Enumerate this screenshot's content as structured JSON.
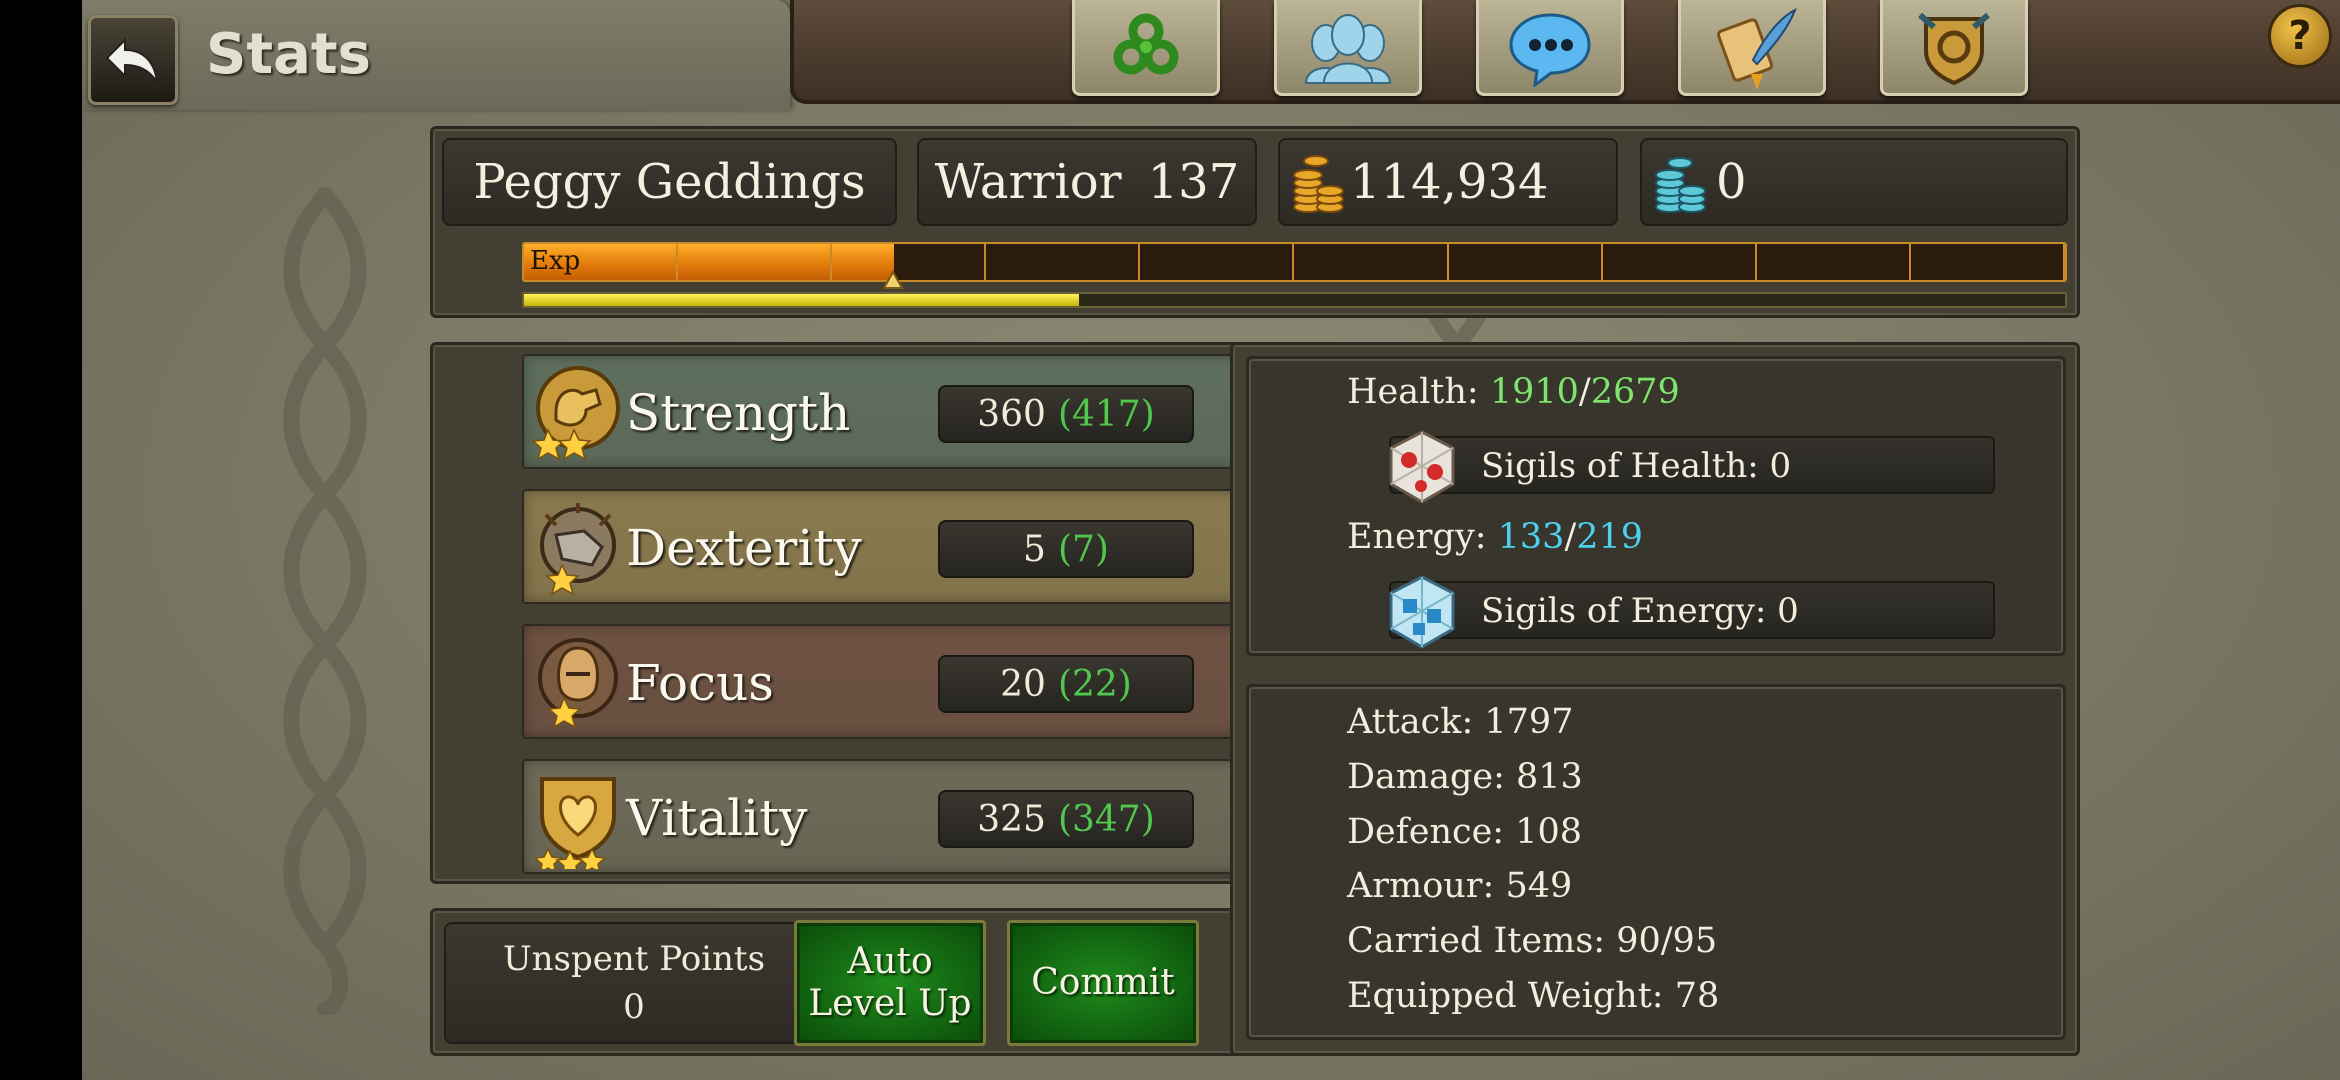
{
  "header": {
    "title": "Stats",
    "nav_buttons": [
      {
        "name": "triskele-icon",
        "color": "#3f9a2a"
      },
      {
        "name": "guild-icon",
        "color": "#8cc8e0"
      },
      {
        "name": "chat-icon",
        "color": "#4aa6e8"
      },
      {
        "name": "quest-scroll-icon",
        "color": "#d9a54a"
      },
      {
        "name": "crest-icon",
        "color": "#c99a3a"
      }
    ],
    "help_label": "?"
  },
  "character": {
    "name": "Peggy Geddings",
    "class": "Warrior",
    "level": "137",
    "gold": "114,934",
    "gems": "0"
  },
  "experience": {
    "label": "Exp",
    "segments": 10,
    "progress": 0.24,
    "sub_progress": 0.36
  },
  "attributes": [
    {
      "name": "Strength",
      "base": "360",
      "total": "(417)",
      "icon": "strength-icon",
      "color": "#5f6f5e"
    },
    {
      "name": "Dexterity",
      "base": "5",
      "total": "(7)",
      "icon": "dexterity-icon",
      "color": "#8a7a4e"
    },
    {
      "name": "Focus",
      "base": "20",
      "total": "(22)",
      "icon": "focus-icon",
      "color": "#6e5242"
    },
    {
      "name": "Vitality",
      "base": "325",
      "total": "(347)",
      "icon": "vitality-icon",
      "color": "#6e6a58"
    }
  ],
  "unspent": {
    "label": "Unspent Points",
    "value": "0"
  },
  "buttons": {
    "auto_level_line1": "Auto",
    "auto_level_line2": "Level Up",
    "commit": "Commit"
  },
  "vitals": {
    "health_label": "Health: ",
    "health_current": "1910",
    "health_max": "2679",
    "health_sigils": "Sigils of Health: 0",
    "energy_label": "Energy: ",
    "energy_current": "133",
    "energy_max": "219",
    "energy_sigils": "Sigils of Energy: 0",
    "slash": "/"
  },
  "combat": {
    "attack": "Attack: 1797",
    "damage": "Damage: 813",
    "defence": "Defence: 108",
    "armour": "Armour: 549",
    "carried": "Carried Items: 90/95",
    "weight": "Equipped Weight: 78"
  }
}
